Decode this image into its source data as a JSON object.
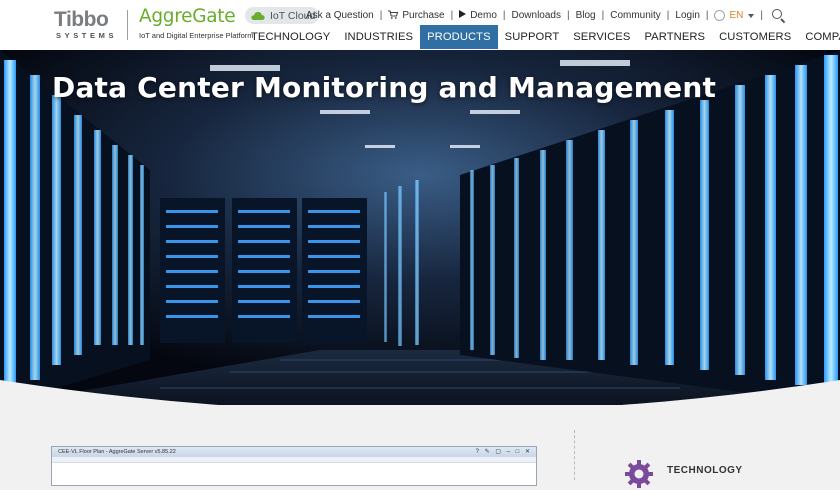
{
  "brand": {
    "tibbo": "Tibbo",
    "tibbo_sub": "SYSTEMS",
    "aggregate": "AggreGate",
    "aggregate_sub": "IoT and Digital Enterprise Platform",
    "iot_badge": "IoT Cloud",
    "iot_icon": "cloud-icon"
  },
  "topbar": {
    "ask": "Ask a Question",
    "purchase": "Purchase",
    "demo": "Demo",
    "downloads": "Downloads",
    "blog": "Blog",
    "community": "Community",
    "login": "Login",
    "lang": "EN",
    "separator": "|"
  },
  "nav": {
    "items": [
      "TECHNOLOGY",
      "INDUSTRIES",
      "PRODUCTS",
      "SUPPORT",
      "SERVICES",
      "PARTNERS",
      "CUSTOMERS",
      "COMPANY"
    ],
    "active": "PRODUCTS"
  },
  "hero": {
    "title": "Data Center Monitoring and Management"
  },
  "content": {
    "screenshot_title": "CEE-VL Floor Plan - AggreGate Server v5.85.22",
    "screenshot_controls": "? ✎ ▢ – □ ✕",
    "sidebar_heading": "TECHNOLOGY"
  },
  "colors": {
    "accent_green": "#6aac2e",
    "nav_active": "#2f6fa3",
    "lang_orange": "#e17f25"
  }
}
